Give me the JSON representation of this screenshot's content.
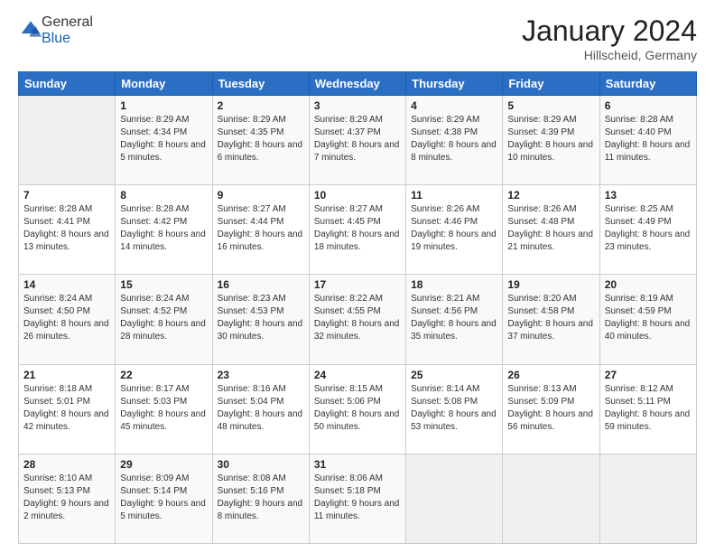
{
  "header": {
    "logo_general": "General",
    "logo_blue": "Blue",
    "title": "January 2024",
    "location": "Hillscheid, Germany"
  },
  "weekdays": [
    "Sunday",
    "Monday",
    "Tuesday",
    "Wednesday",
    "Thursday",
    "Friday",
    "Saturday"
  ],
  "weeks": [
    [
      {
        "day": "",
        "sunrise": "",
        "sunset": "",
        "daylight": "",
        "empty": true
      },
      {
        "day": "1",
        "sunrise": "8:29 AM",
        "sunset": "4:34 PM",
        "daylight": "8 hours and 5 minutes."
      },
      {
        "day": "2",
        "sunrise": "8:29 AM",
        "sunset": "4:35 PM",
        "daylight": "8 hours and 6 minutes."
      },
      {
        "day": "3",
        "sunrise": "8:29 AM",
        "sunset": "4:37 PM",
        "daylight": "8 hours and 7 minutes."
      },
      {
        "day": "4",
        "sunrise": "8:29 AM",
        "sunset": "4:38 PM",
        "daylight": "8 hours and 8 minutes."
      },
      {
        "day": "5",
        "sunrise": "8:29 AM",
        "sunset": "4:39 PM",
        "daylight": "8 hours and 10 minutes."
      },
      {
        "day": "6",
        "sunrise": "8:28 AM",
        "sunset": "4:40 PM",
        "daylight": "8 hours and 11 minutes."
      }
    ],
    [
      {
        "day": "7",
        "sunrise": "8:28 AM",
        "sunset": "4:41 PM",
        "daylight": "8 hours and 13 minutes."
      },
      {
        "day": "8",
        "sunrise": "8:28 AM",
        "sunset": "4:42 PM",
        "daylight": "8 hours and 14 minutes."
      },
      {
        "day": "9",
        "sunrise": "8:27 AM",
        "sunset": "4:44 PM",
        "daylight": "8 hours and 16 minutes."
      },
      {
        "day": "10",
        "sunrise": "8:27 AM",
        "sunset": "4:45 PM",
        "daylight": "8 hours and 18 minutes."
      },
      {
        "day": "11",
        "sunrise": "8:26 AM",
        "sunset": "4:46 PM",
        "daylight": "8 hours and 19 minutes."
      },
      {
        "day": "12",
        "sunrise": "8:26 AM",
        "sunset": "4:48 PM",
        "daylight": "8 hours and 21 minutes."
      },
      {
        "day": "13",
        "sunrise": "8:25 AM",
        "sunset": "4:49 PM",
        "daylight": "8 hours and 23 minutes."
      }
    ],
    [
      {
        "day": "14",
        "sunrise": "8:24 AM",
        "sunset": "4:50 PM",
        "daylight": "8 hours and 26 minutes."
      },
      {
        "day": "15",
        "sunrise": "8:24 AM",
        "sunset": "4:52 PM",
        "daylight": "8 hours and 28 minutes."
      },
      {
        "day": "16",
        "sunrise": "8:23 AM",
        "sunset": "4:53 PM",
        "daylight": "8 hours and 30 minutes."
      },
      {
        "day": "17",
        "sunrise": "8:22 AM",
        "sunset": "4:55 PM",
        "daylight": "8 hours and 32 minutes."
      },
      {
        "day": "18",
        "sunrise": "8:21 AM",
        "sunset": "4:56 PM",
        "daylight": "8 hours and 35 minutes."
      },
      {
        "day": "19",
        "sunrise": "8:20 AM",
        "sunset": "4:58 PM",
        "daylight": "8 hours and 37 minutes."
      },
      {
        "day": "20",
        "sunrise": "8:19 AM",
        "sunset": "4:59 PM",
        "daylight": "8 hours and 40 minutes."
      }
    ],
    [
      {
        "day": "21",
        "sunrise": "8:18 AM",
        "sunset": "5:01 PM",
        "daylight": "8 hours and 42 minutes."
      },
      {
        "day": "22",
        "sunrise": "8:17 AM",
        "sunset": "5:03 PM",
        "daylight": "8 hours and 45 minutes."
      },
      {
        "day": "23",
        "sunrise": "8:16 AM",
        "sunset": "5:04 PM",
        "daylight": "8 hours and 48 minutes."
      },
      {
        "day": "24",
        "sunrise": "8:15 AM",
        "sunset": "5:06 PM",
        "daylight": "8 hours and 50 minutes."
      },
      {
        "day": "25",
        "sunrise": "8:14 AM",
        "sunset": "5:08 PM",
        "daylight": "8 hours and 53 minutes."
      },
      {
        "day": "26",
        "sunrise": "8:13 AM",
        "sunset": "5:09 PM",
        "daylight": "8 hours and 56 minutes."
      },
      {
        "day": "27",
        "sunrise": "8:12 AM",
        "sunset": "5:11 PM",
        "daylight": "8 hours and 59 minutes."
      }
    ],
    [
      {
        "day": "28",
        "sunrise": "8:10 AM",
        "sunset": "5:13 PM",
        "daylight": "9 hours and 2 minutes."
      },
      {
        "day": "29",
        "sunrise": "8:09 AM",
        "sunset": "5:14 PM",
        "daylight": "9 hours and 5 minutes."
      },
      {
        "day": "30",
        "sunrise": "8:08 AM",
        "sunset": "5:16 PM",
        "daylight": "9 hours and 8 minutes."
      },
      {
        "day": "31",
        "sunrise": "8:06 AM",
        "sunset": "5:18 PM",
        "daylight": "9 hours and 11 minutes."
      },
      {
        "day": "",
        "sunrise": "",
        "sunset": "",
        "daylight": "",
        "empty": true
      },
      {
        "day": "",
        "sunrise": "",
        "sunset": "",
        "daylight": "",
        "empty": true
      },
      {
        "day": "",
        "sunrise": "",
        "sunset": "",
        "daylight": "",
        "empty": true
      }
    ]
  ],
  "labels": {
    "sunrise": "Sunrise: ",
    "sunset": "Sunset: ",
    "daylight": "Daylight: "
  }
}
